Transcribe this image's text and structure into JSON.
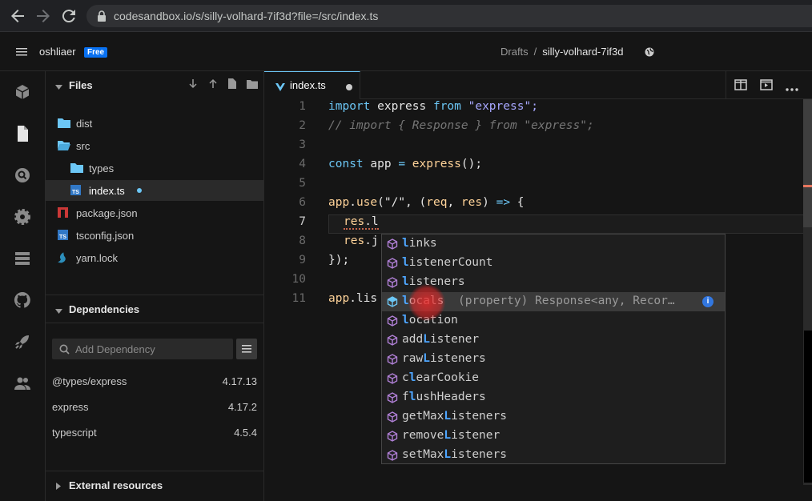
{
  "browser": {
    "url": "codesandbox.io/s/silly-volhard-7if3d?file=/src/index.ts"
  },
  "header": {
    "user": "oshliaer",
    "plan_badge": "Free",
    "breadcrumb_folder": "Drafts",
    "breadcrumb_sep": "/",
    "sandbox_name": "silly-volhard-7if3d"
  },
  "files": {
    "title": "Files",
    "items": [
      {
        "name": "dist",
        "icon": "folder-icon"
      },
      {
        "name": "src",
        "icon": "folder-open-icon"
      },
      {
        "name": "types",
        "icon": "folder-icon"
      },
      {
        "name": "index.ts",
        "icon": "typescript-file-icon"
      },
      {
        "name": "package.json",
        "icon": "npm-icon"
      },
      {
        "name": "tsconfig.json",
        "icon": "typescript-config-icon"
      },
      {
        "name": "yarn.lock",
        "icon": "yarn-icon"
      }
    ]
  },
  "dependencies": {
    "title": "Dependencies",
    "search_placeholder": "Add Dependency",
    "items": [
      {
        "name": "@types/express",
        "version": "4.17.13"
      },
      {
        "name": "express",
        "version": "4.17.2"
      },
      {
        "name": "typescript",
        "version": "4.5.4"
      }
    ]
  },
  "external": {
    "title": "External resources"
  },
  "editor": {
    "tab_name": "index.ts",
    "line_numbers": [
      "1",
      "2",
      "3",
      "4",
      "5",
      "6",
      "7",
      "8",
      "9",
      "10",
      "11"
    ],
    "lines": {
      "l1": [
        "import",
        " express ",
        "from",
        " \"express\";"
      ],
      "l2": "// import { Response } from \"express\";",
      "l4": [
        "const",
        " app ",
        "=",
        " express",
        "();"
      ],
      "l6": [
        "app",
        ".",
        "use",
        "(\"/\", (",
        "req",
        ", ",
        "res",
        ") ",
        "=>",
        " {"
      ],
      "l7": [
        "res",
        ".l"
      ],
      "l8": [
        "res",
        ".j"
      ],
      "l9": "});",
      "l11": [
        "app",
        ".lis"
      ]
    }
  },
  "suggestions": [
    {
      "bold": "l",
      "rest": "inks",
      "pre": ""
    },
    {
      "bold": "l",
      "rest": "istenerCount",
      "pre": ""
    },
    {
      "bold": "l",
      "rest": "isteners",
      "pre": ""
    },
    {
      "bold": "l",
      "rest": "ocals",
      "pre": "",
      "detail": "(property) Response<any, Recor…",
      "info": "i"
    },
    {
      "bold": "l",
      "rest": "ocation",
      "pre": ""
    },
    {
      "bold": "L",
      "rest": "istener",
      "pre": "add"
    },
    {
      "bold": "L",
      "rest": "isteners",
      "pre": "raw"
    },
    {
      "bold": "l",
      "rest": "earCookie",
      "pre": "c"
    },
    {
      "bold": "l",
      "rest": "ushHeaders",
      "pre": "f"
    },
    {
      "bold": "L",
      "rest": "isteners",
      "pre": "getMax"
    },
    {
      "bold": "L",
      "rest": "istener",
      "pre": "remove"
    },
    {
      "bold": "L",
      "rest": "isteners",
      "pre": "setMax"
    }
  ]
}
